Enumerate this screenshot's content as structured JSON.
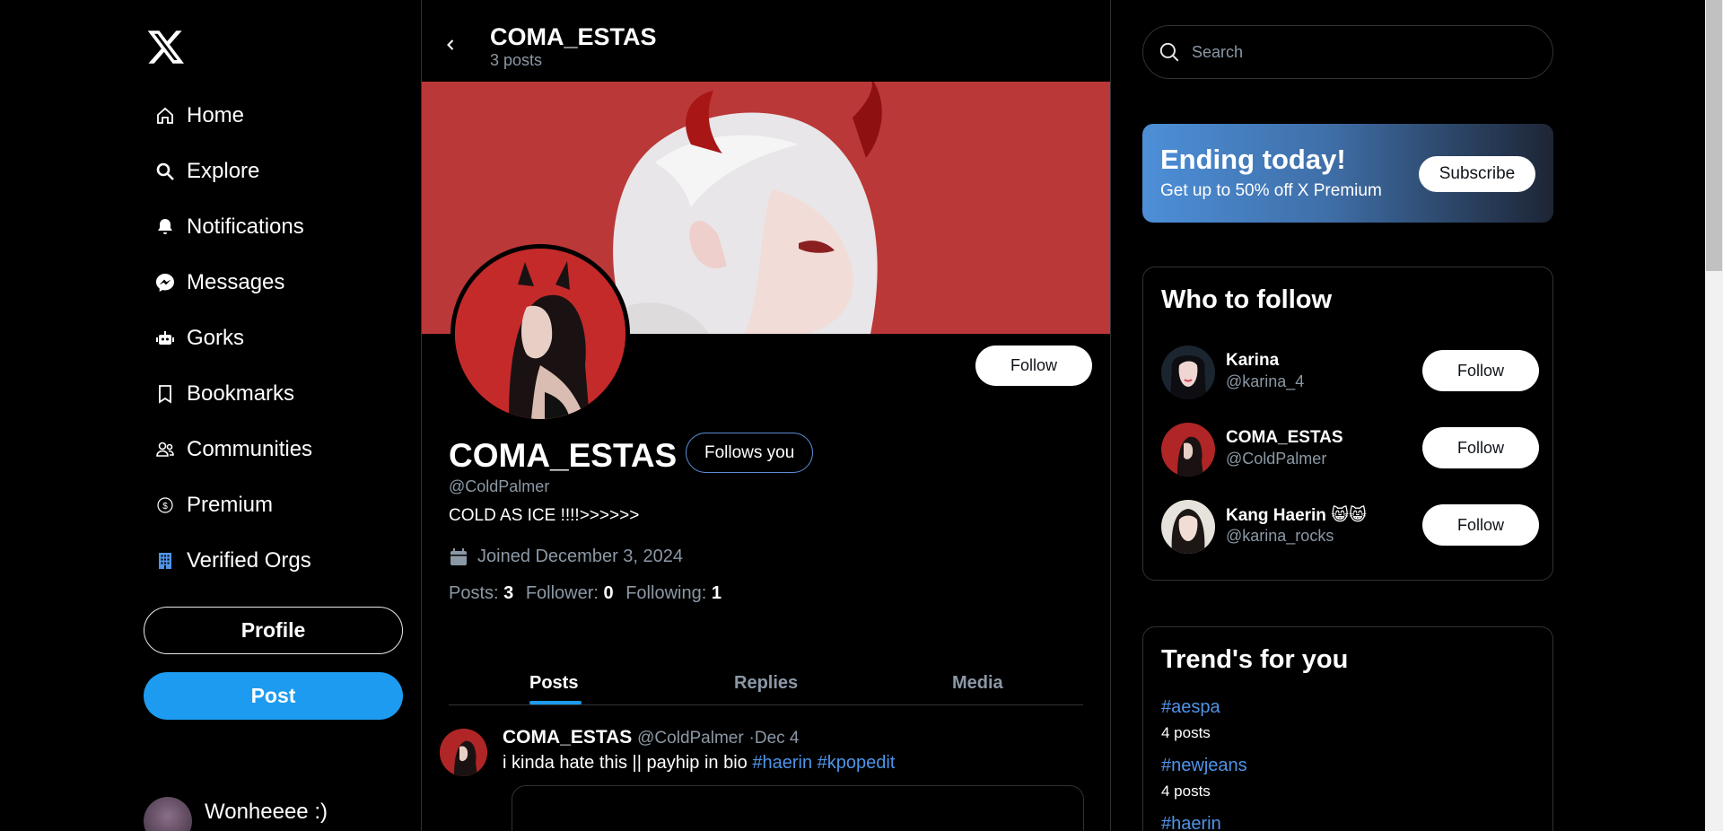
{
  "nav": {
    "items": [
      {
        "label": "Home",
        "icon": "home-icon"
      },
      {
        "label": "Explore",
        "icon": "search-icon"
      },
      {
        "label": "Notifications",
        "icon": "bell-icon"
      },
      {
        "label": "Messages",
        "icon": "messenger-icon"
      },
      {
        "label": "Gorks",
        "icon": "robot-icon"
      },
      {
        "label": "Bookmarks",
        "icon": "bookmark-icon"
      },
      {
        "label": "Communities",
        "icon": "people-icon"
      },
      {
        "label": "Premium",
        "icon": "dollar-circle-icon"
      },
      {
        "label": "Verified Orgs",
        "icon": "building-icon"
      }
    ],
    "profile_label": "Profile",
    "post_label": "Post",
    "account_name": "Wonheeee :)"
  },
  "header": {
    "title": "COMA_ESTAS",
    "subtitle": "3 posts"
  },
  "profile": {
    "follow_label": "Follow",
    "name": "COMA_ESTAS",
    "follows_you": "Follows you",
    "handle": "@ColdPalmer",
    "bio": "COLD AS ICE !!!!>>>>>>",
    "joined": "Joined December 3, 2024",
    "stats": {
      "posts_label": "Posts:",
      "posts": "3",
      "followers_label": "Follower:",
      "followers": "0",
      "following_label": "Following:",
      "following": "1"
    },
    "colors": {
      "banner": "#bb3838",
      "accent": "#1d9bf0"
    }
  },
  "tabs": [
    {
      "label": "Posts",
      "active": true
    },
    {
      "label": "Replies",
      "active": false
    },
    {
      "label": "Media",
      "active": false
    }
  ],
  "post": {
    "name": "COMA_ESTAS",
    "handle": "@ColdPalmer",
    "date": "·Dec 4",
    "text": "i kinda hate this || payhip in bio",
    "tag1": "#haerin",
    "tag2": "#kpopedit"
  },
  "search": {
    "placeholder": "Search"
  },
  "promo": {
    "title": "Ending today!",
    "subtitle": "Get up to 50% off X Premium",
    "button": "Subscribe"
  },
  "who_to_follow": {
    "title": "Who to follow",
    "users": [
      {
        "name": "Karina",
        "handle": "@karina_4",
        "button": "Follow"
      },
      {
        "name": "COMA_ESTAS",
        "handle": "@ColdPalmer",
        "button": "Follow"
      },
      {
        "name": "Kang Haerin 😸😸",
        "handle": "@karina_rocks",
        "button": "Follow"
      }
    ]
  },
  "trends": {
    "title": "Trend's for you",
    "items": [
      {
        "tag": "#aespa",
        "count": "4 posts"
      },
      {
        "tag": "#newjeans",
        "count": "4 posts"
      },
      {
        "tag": "#haerin",
        "count": ""
      }
    ]
  }
}
